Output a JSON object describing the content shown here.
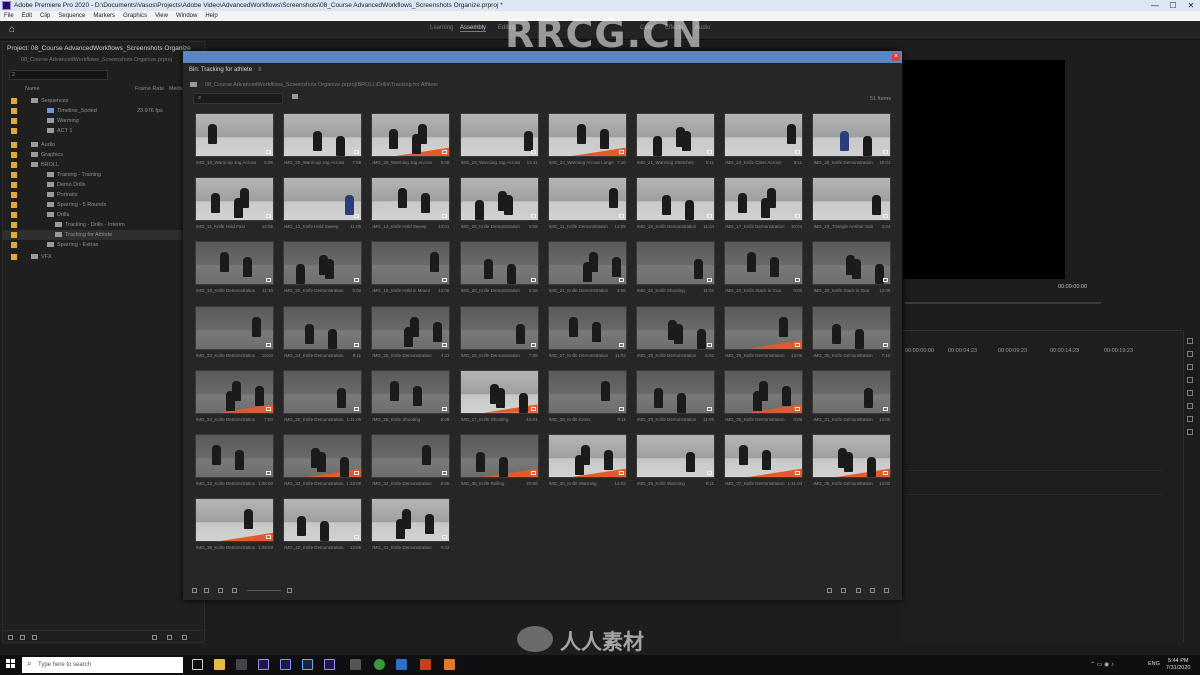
{
  "window": {
    "title": "Adobe Premiere Pro 2020 - D:\\Documents\\Vasos\\Projects\\Adobe Video\\AdvancedWorkflows\\Screenshots\\08_Course AdvancedWorkflows_Screenshots Organize.prproj *",
    "controls": [
      "—",
      "☐",
      "✕"
    ]
  },
  "menu": [
    "File",
    "Edit",
    "Clip",
    "Sequence",
    "Markers",
    "Graphics",
    "View",
    "Window",
    "Help"
  ],
  "workspace_tabs": [
    "Learning",
    "Assembly",
    "Editing",
    "Color",
    "Effects",
    "Audio"
  ],
  "project_panel": {
    "title": "Project: 08_Course AdvancedWorkflows_Screenshots Organize",
    "path": "08_Course AdvancedWorkflows_Screenshots Organize.prproj",
    "search_value": "2",
    "columns": [
      "Name",
      "Frame Rate",
      "Media"
    ],
    "items": [
      {
        "label": "Sequences",
        "value": ""
      },
      {
        "label": "Timeline_Sorted",
        "value": "23.976 fps"
      },
      {
        "label": "Warming",
        "value": ""
      },
      {
        "label": "ACT 1",
        "value": ""
      },
      {
        "label": "Audio",
        "value": ""
      },
      {
        "label": "Graphics",
        "value": ""
      },
      {
        "label": "BROLL",
        "value": ""
      },
      {
        "label": "Training - Training",
        "value": ""
      },
      {
        "label": "Demo Drills",
        "value": ""
      },
      {
        "label": "Portraits",
        "value": ""
      },
      {
        "label": "Sparring - 5 Rounds",
        "value": ""
      },
      {
        "label": "Drills",
        "value": ""
      },
      {
        "label": "Tracking - Drills - Interim",
        "value": ""
      },
      {
        "label": "Tracking for Athlete",
        "value": ""
      },
      {
        "label": "Sparring - Extras",
        "value": ""
      },
      {
        "label": "VFX",
        "value": ""
      }
    ]
  },
  "bin": {
    "tab_label": "Bin: Tracking for athlete",
    "path": "08_Course AdvancedWorkflows_Screenshots Organize.prproj\\BROLL\\Drills\\Tracking for Athlete",
    "item_count": "51 Items",
    "clips": [
      {
        "name": "IMG_19_Warm-up Jog Across",
        "dur": "5:05"
      },
      {
        "name": "IMG_20_Warm-up Jog Across",
        "dur": "7:08"
      },
      {
        "name": "IMG_20_Warming Jog Across",
        "dur": "5:08"
      },
      {
        "name": "IMG_23_Warming Jog Across",
        "dur": "13:11"
      },
      {
        "name": "IMG_23_Warming Across Lunge",
        "dur": "7:10"
      },
      {
        "name": "IMG_21_Warming Stretches",
        "dur": "6:11"
      },
      {
        "name": "IMG_24_Knife Class Across",
        "dur": "9:11"
      },
      {
        "name": "IMG_28_Knife Demonstration",
        "dur": "10:01"
      },
      {
        "name": "IMG_11_Knife Hold Fast",
        "dur": "12:05"
      },
      {
        "name": "IMG_13_Knife Hold Sweep",
        "dur": "11:05"
      },
      {
        "name": "IMG_14_Knife Hold Sweep",
        "dur": "10:01"
      },
      {
        "name": "IMG_15_Knife Demonstration",
        "dur": "9:09"
      },
      {
        "name": "IMG_11_Knife Demonstration",
        "dur": "13:09"
      },
      {
        "name": "IMG_16_Knife Demonstration",
        "dur": "11:04"
      },
      {
        "name": "IMG_17_Knife Demonstration",
        "dur": "10:04"
      },
      {
        "name": "IMG_18_Triangle Armbar Sub",
        "dur": "4:04"
      },
      {
        "name": "IMG_19_Knife Demonstration",
        "dur": "11:10"
      },
      {
        "name": "IMG_20_Knife Demonstration",
        "dur": "9:00"
      },
      {
        "name": "IMG_19_Knife Hold in Mount",
        "dur": "13:06"
      },
      {
        "name": "IMG_20_Knife Demonstration",
        "dur": "8:06"
      },
      {
        "name": "IMG_21_Knife Demonstration",
        "dur": "4:06"
      },
      {
        "name": "IMG_22_Knife Shooting",
        "dur": "11:02"
      },
      {
        "name": "IMG_22_Knife Stack in Gua",
        "dur": "9:00"
      },
      {
        "name": "IMG_22_Knife Stack in Gua",
        "dur": "13:09"
      },
      {
        "name": "IMG_23_Knife Demonstration",
        "dur": "10:04"
      },
      {
        "name": "IMG_24_Knife Demonstration",
        "dur": "8:11"
      },
      {
        "name": "IMG_25_Knife Demonstration",
        "dur": "4:11"
      },
      {
        "name": "IMG_26_Knife Demonstration",
        "dur": "7:08"
      },
      {
        "name": "IMG_27_Knife Demonstration",
        "dur": "11:02"
      },
      {
        "name": "IMG_28_Knife Demonstration",
        "dur": "6:02"
      },
      {
        "name": "IMG_29_Knife Demonstration",
        "dur": "13:06"
      },
      {
        "name": "IMG_30_Knife Demonstration",
        "dur": "7:10"
      },
      {
        "name": "IMG_24_Knife Demonstration",
        "dur": "7:04"
      },
      {
        "name": "IMG_25_Knife Demonstration",
        "dur": "1:11:05"
      },
      {
        "name": "IMG_26_Knife Shooting",
        "dur": "9:09"
      },
      {
        "name": "IMG_27_Knife Shooting",
        "dur": "10:01"
      },
      {
        "name": "IMG_28_Knife Cross",
        "dur": "9:11"
      },
      {
        "name": "IMG_29_Knife Demonstration",
        "dur": "11:05"
      },
      {
        "name": "IMG_30_Knife Demonstration",
        "dur": "9:08"
      },
      {
        "name": "IMG_31_Knife Demonstration",
        "dur": "13:05"
      },
      {
        "name": "IMG_32_Knife Demonstration",
        "dur": "1:08:00"
      },
      {
        "name": "IMG_33_Knife Demonstration",
        "dur": "1:13:09"
      },
      {
        "name": "IMG_34_Knife Demonstration",
        "dur": "8:00"
      },
      {
        "name": "IMG_35_Knife Rolling",
        "dur": "20:06"
      },
      {
        "name": "IMG_36_Knife Warming",
        "dur": "14:02"
      },
      {
        "name": "IMG_36_Knife Warming",
        "dur": "9:11"
      },
      {
        "name": "IMG_37_Knife Demonstration",
        "dur": "1:11:04"
      },
      {
        "name": "IMG_38_Knife Demonstration",
        "dur": "13:02"
      },
      {
        "name": "IMG_39_Knife Demonstration",
        "dur": "1:08:03"
      },
      {
        "name": "IMG_40_Knife Demonstration",
        "dur": "12:06"
      },
      {
        "name": "IMG_41_Knife Demonstration",
        "dur": "6:11"
      }
    ]
  },
  "program_monitor": {
    "timecode": "00:00:00:00"
  },
  "timeline": {
    "ruler": [
      "00:00:00:00",
      "00:00:04:23",
      "00:00:09:23",
      "00:00:14:23",
      "00:00:19:23"
    ]
  },
  "taskbar": {
    "search_placeholder": "Type here to search",
    "lang": "ENG",
    "time": "5:44 PM",
    "date": "7/31/2020"
  },
  "watermarks": {
    "top": "RRCG.CN",
    "bottom": "人人素材"
  },
  "colors": {
    "accent": "#2d8ceb",
    "bin_titlebar": "#5a86c6",
    "label_orange": "#e2a83b",
    "mat": "#e35a2c"
  }
}
